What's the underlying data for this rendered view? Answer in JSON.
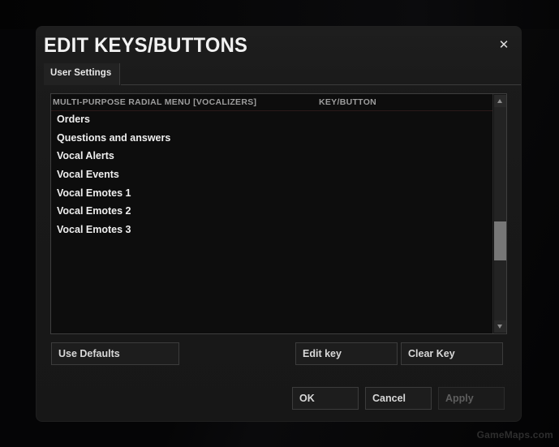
{
  "window": {
    "title": "EDIT KEYS/BUTTONS",
    "close_icon": "close-icon",
    "close_glyph": "✕"
  },
  "tabs": [
    {
      "label": "User Settings",
      "selected": true
    }
  ],
  "list": {
    "columns": [
      "MULTI-PURPOSE RADIAL MENU [VOCALIZERS]",
      "KEY/BUTTON"
    ],
    "rows": [
      {
        "name": "Orders",
        "key": ""
      },
      {
        "name": "Questions and answers",
        "key": ""
      },
      {
        "name": "Vocal Alerts",
        "key": ""
      },
      {
        "name": "Vocal Events",
        "key": ""
      },
      {
        "name": "Vocal Emotes 1",
        "key": ""
      },
      {
        "name": "Vocal Emotes 2",
        "key": ""
      },
      {
        "name": "Vocal Emotes 3",
        "key": ""
      }
    ],
    "scrollbar": {
      "up_icon": "scroll-up-arrow-icon",
      "down_icon": "scroll-down-arrow-icon"
    }
  },
  "actions": {
    "use_defaults": "Use Defaults",
    "edit_key": "Edit key",
    "clear_key": "Clear Key"
  },
  "footer": {
    "ok": "OK",
    "cancel": "Cancel",
    "apply": "Apply",
    "apply_enabled": false
  },
  "watermark": "GameMaps.com",
  "colors": {
    "dialog_bg": "#1a1a1a",
    "panel_bg": "#0d0d0d",
    "text": "#efefef",
    "muted_text": "#9d9d9d",
    "disabled_text": "#5e5e5e",
    "border": "#3c3c3c",
    "scroll_thumb": "#777777"
  }
}
